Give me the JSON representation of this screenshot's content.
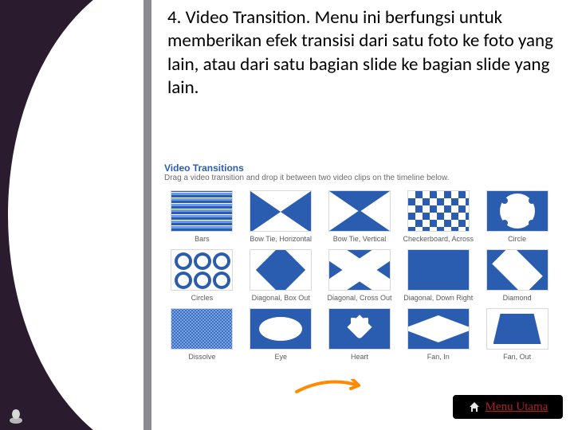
{
  "slide": {
    "body_text": "4. Video Transition. Menu ini berfungsi untuk memberikan efek transisi dari satu foto ke foto yang lain, atau dari satu bagian slide ke bagian slide yang lain."
  },
  "panel": {
    "title": "Video Transitions",
    "subtitle": "Drag a video transition and drop it between two video clips on the timeline below.",
    "items": [
      {
        "label": "Bars",
        "icon": "bars"
      },
      {
        "label": "Bow Tie, Horizontal",
        "icon": "bowtie-h"
      },
      {
        "label": "Bow Tie, Vertical",
        "icon": "bowtie-v"
      },
      {
        "label": "Checkerboard, Across",
        "icon": "checker"
      },
      {
        "label": "Circle",
        "icon": "circle"
      },
      {
        "label": "Circles",
        "icon": "circles"
      },
      {
        "label": "Diagonal, Box Out",
        "icon": "diamond2"
      },
      {
        "label": "Diagonal, Cross Out",
        "icon": "cross"
      },
      {
        "label": "Diagonal, Down Right",
        "icon": "diag"
      },
      {
        "label": "Diamond",
        "icon": "diamond"
      },
      {
        "label": "Dissolve",
        "icon": "dissolve"
      },
      {
        "label": "Eye",
        "icon": "eye"
      },
      {
        "label": "Heart",
        "icon": "heart"
      },
      {
        "label": "Fan, In",
        "icon": "fanin"
      },
      {
        "label": "Fan, Out",
        "icon": "fanout"
      }
    ]
  },
  "nav": {
    "menu_label": "Menu Utama"
  }
}
